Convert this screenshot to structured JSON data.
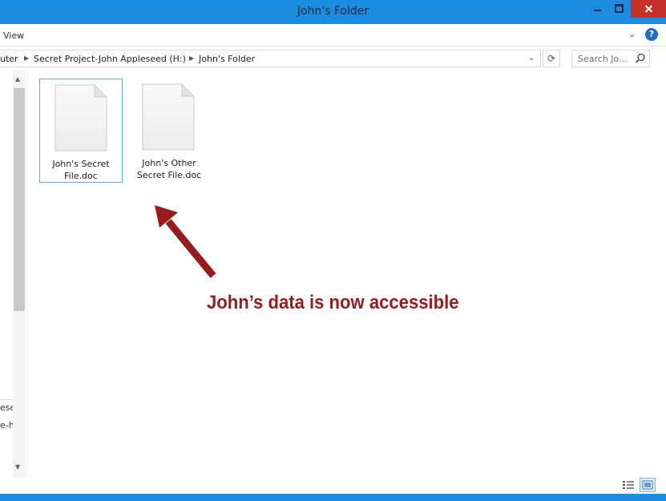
{
  "window": {
    "title": "John's Folder",
    "accent": "#1c8ce0",
    "close_color": "#c7302b"
  },
  "ribbon": {
    "view_tab": "View",
    "expand_icon": "chevron-down-icon",
    "help_label": "?"
  },
  "address": {
    "crumbs": [
      "uter",
      "Secret Project-John Appleseed (H:)",
      "John's Folder"
    ],
    "search_placeholder": "Search Jo..."
  },
  "nav_pane": {
    "items": [
      "ese",
      "e-h"
    ]
  },
  "files": [
    {
      "name": "John's Secret File.doc",
      "line1": "John's Secret",
      "line2": "File.doc",
      "selected": true
    },
    {
      "name": "John's Other Secret File.doc",
      "line1": "John's Other",
      "line2": "Secret File.doc",
      "selected": false
    }
  ],
  "annotation": {
    "text": "John’s data is now accessible",
    "color": "#981b1e"
  }
}
